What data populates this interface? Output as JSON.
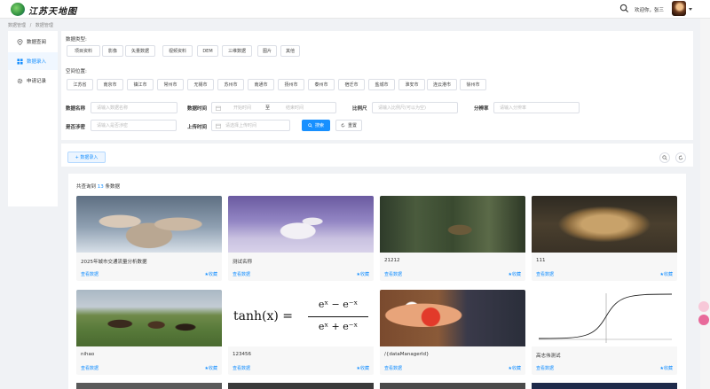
{
  "header": {
    "logo_text": "江苏天地图",
    "greeting": "欢迎你，张三"
  },
  "breadcrumb": [
    "数据管理",
    "/",
    "数据管理"
  ],
  "sidebar": {
    "items": [
      {
        "label": "数据查阅",
        "icon": "location-icon",
        "active": false
      },
      {
        "label": "数据录入",
        "icon": "grid-icon",
        "active": true
      },
      {
        "label": "申请记录",
        "icon": "gear-icon",
        "active": false
      }
    ]
  },
  "filter": {
    "type_label": "数据类型:",
    "types": [
      "项目资料",
      "影像",
      "矢量数据",
      "视频资料",
      "DEM",
      "三维数据",
      "图片",
      "其他"
    ],
    "location_label": "空间位置:",
    "locations": [
      "江苏省",
      "南京市",
      "镇江市",
      "常州市",
      "无锡市",
      "苏州市",
      "南通市",
      "扬州市",
      "泰州市",
      "宿迁市",
      "盐城市",
      "淮安市",
      "连云港市",
      "徐州市"
    ],
    "name_label": "数据名称",
    "name_placeholder": "请输入数据名称",
    "time_label": "数据时间",
    "start_placeholder": "开始时间",
    "to_text": "至",
    "end_placeholder": "结束时间",
    "scale_label": "比例尺",
    "scale_placeholder": "请输入比例尺(可以为空)",
    "resolution_label": "分辨率",
    "resolution_placeholder": "请输入分辨率",
    "secret_label": "是否涉密",
    "secret_placeholder": "请输入是否涉密",
    "upload_label": "上传时间",
    "upload_placeholder": "请选择上传时间",
    "search_button": "搜索",
    "reset_button": "重置"
  },
  "toolbar": {
    "add_button": "+ 数据录入"
  },
  "results": {
    "count_prefix": "共查询到",
    "count": "13",
    "count_suffix": "条数据",
    "view_label": "查看数据",
    "fav_label": "★收藏",
    "cards": [
      {
        "title": "2025年城市交通流量分析数据",
        "image": "monkeys-in-snow"
      },
      {
        "title": "测试名称",
        "image": "arctic-fox"
      },
      {
        "title": "21212",
        "image": "deer-in-forest"
      },
      {
        "title": "111",
        "image": "lioness"
      },
      {
        "title": "nihao",
        "image": "horses-on-hill"
      },
      {
        "title": "123456",
        "image": "tanh-formula"
      },
      {
        "title": "/{dataManagerId}",
        "image": "cartoon-character"
      },
      {
        "title": "高志伟测试",
        "image": "sigmoid-plot"
      }
    ]
  },
  "formula": {
    "lhs": "tanh(x) =",
    "num": "eˣ − e⁻ˣ",
    "den": "eˣ + e⁻ˣ"
  },
  "colors": {
    "primary": "#1890ff",
    "background": "#f0f2f5"
  }
}
